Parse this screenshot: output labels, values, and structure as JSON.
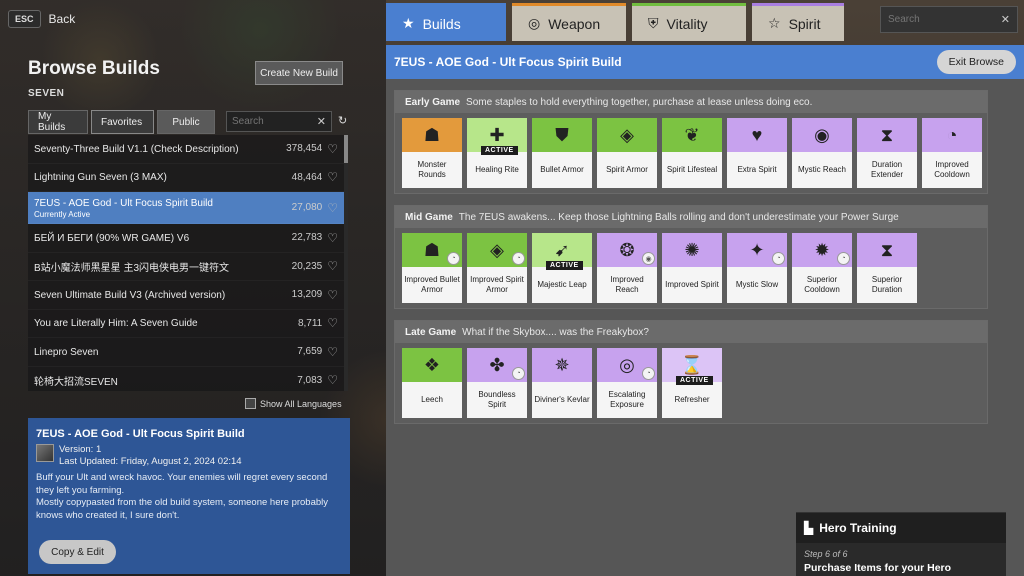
{
  "nav": {
    "esc_key": "ESC",
    "back_label": "Back"
  },
  "left": {
    "title": "Browse Builds",
    "hero": "SEVEN",
    "create_button": "Create New Build",
    "tabs": [
      "My Builds",
      "Favorites",
      "Public"
    ],
    "search_placeholder": "Search",
    "builds": [
      {
        "name": "Seventy-Three Build V1.1 (Check Description)",
        "count": "378,454"
      },
      {
        "name": "Lightning Gun Seven (3 MAX)",
        "count": "48,464"
      },
      {
        "name": "7EUS - AOE God - Ult Focus Spirit Build",
        "count": "27,080",
        "sub": "Currently Active"
      },
      {
        "name": "БЕЙ И БЕГИ (90% WR GAME) V6",
        "count": "22,783"
      },
      {
        "name": "B站小魔法师黑星星 主3闪电侠电男一键符文",
        "count": "20,235"
      },
      {
        "name": "Seven Ultimate Build V3 (Archived version)",
        "count": "13,209"
      },
      {
        "name": "You are Literally Him: A Seven Guide",
        "count": "8,711"
      },
      {
        "name": "Linepro Seven",
        "count": "7,659"
      },
      {
        "name": "轮椅大招流SEVEN",
        "count": "7,083"
      }
    ],
    "show_all_languages": "Show All Languages",
    "detail": {
      "title": "7EUS - AOE God - Ult Focus Spirit Build",
      "version": "Version: 1",
      "updated": "Last Updated: Friday, August 2, 2024 02:14",
      "desc1": "Buff your Ult and wreck havoc. Your enemies will regret every second they left you farming.",
      "desc2": "Mostly copypasted from the old build system, someone here probably knows who created it, I sure don't.",
      "copy_button": "Copy & Edit"
    }
  },
  "right": {
    "tabs": [
      "Builds",
      "Weapon",
      "Vitality",
      "Spirit"
    ],
    "search_placeholder": "Search",
    "build_title": "7EUS - AOE God - Ult Focus Spirit Build",
    "exit_button": "Exit Browse",
    "sections": [
      {
        "title": "Early Game",
        "desc": "Some staples to hold everything together, purchase at lease unless doing eco.",
        "items": [
          {
            "label": "Monster Rounds",
            "color": "orange",
            "icon": "☗"
          },
          {
            "label": "Healing Rite",
            "color": "lightgreen",
            "icon": "✚",
            "active": "ACTIVE"
          },
          {
            "label": "Bullet Armor",
            "color": "green",
            "icon": "⛊"
          },
          {
            "label": "Spirit Armor",
            "color": "green",
            "icon": "◈"
          },
          {
            "label": "Spirit Lifesteal",
            "color": "green",
            "icon": "❦"
          },
          {
            "label": "Extra Spirit",
            "color": "purple",
            "icon": "♥"
          },
          {
            "label": "Mystic Reach",
            "color": "purple",
            "icon": "◉"
          },
          {
            "label": "Duration Extender",
            "color": "purple",
            "icon": "⧗"
          },
          {
            "label": "Improved Cooldown",
            "color": "purple",
            "icon": "◔"
          }
        ]
      },
      {
        "title": "Mid Game",
        "desc": "The 7EUS awakens... Keep those Lightning Balls rolling and don't underestimate your Power Surge",
        "items": [
          {
            "label": "Improved Bullet Armor",
            "color": "green",
            "icon": "☗",
            "mini": "◔"
          },
          {
            "label": "Improved Spirit Armor",
            "color": "green",
            "icon": "◈",
            "mini": "◔"
          },
          {
            "label": "Majestic Leap",
            "color": "lightgreen",
            "icon": "➹",
            "active": "ACTIVE"
          },
          {
            "label": "Improved Reach",
            "color": "purple",
            "icon": "❂",
            "mini": "◉"
          },
          {
            "label": "Improved Spirit",
            "color": "purple",
            "icon": "✺"
          },
          {
            "label": "Mystic Slow",
            "color": "purple",
            "icon": "✦",
            "mini": "◔"
          },
          {
            "label": "Superior Cooldown",
            "color": "purple",
            "icon": "✹",
            "mini": "◔"
          },
          {
            "label": "Superior Duration",
            "color": "purple",
            "icon": "⧗"
          }
        ]
      },
      {
        "title": "Late Game",
        "desc": "What if the Skybox.... was the Freakybox?",
        "items": [
          {
            "label": "Leech",
            "color": "green",
            "icon": "❖"
          },
          {
            "label": "Boundless Spirit",
            "color": "purple",
            "icon": "✤",
            "mini": "◔"
          },
          {
            "label": "Diviner's Kevlar",
            "color": "purple",
            "icon": "✵"
          },
          {
            "label": "Escalating Exposure",
            "color": "purple",
            "icon": "◎",
            "mini": "◔"
          },
          {
            "label": "Refresher",
            "color": "lightpurple",
            "icon": "⌛",
            "active": "ACTIVE"
          }
        ]
      }
    ],
    "hero_training": {
      "title": "Hero Training",
      "step": "Step 6 of 6",
      "task": "Purchase Items for your Hero"
    }
  }
}
